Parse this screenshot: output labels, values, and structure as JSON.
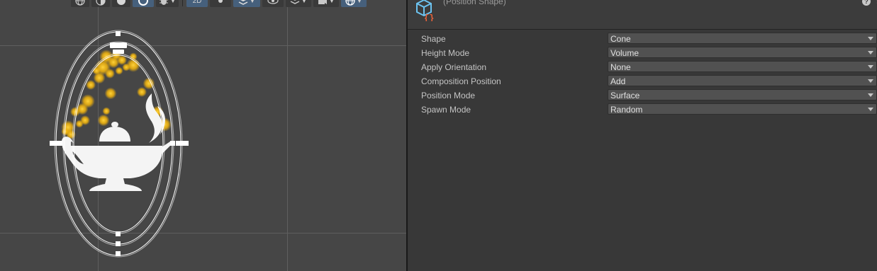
{
  "scene": {
    "toolbar": {
      "mode_2d_label": "2D"
    }
  },
  "inspector": {
    "block_title": "(Position Shape)",
    "help_glyph": "?",
    "menu_glyph": "⋮",
    "properties": [
      {
        "label": "Shape",
        "value": "Cone"
      },
      {
        "label": "Height Mode",
        "value": "Volume"
      },
      {
        "label": "Apply Orientation",
        "value": "None"
      },
      {
        "label": "Composition Position",
        "value": "Add"
      },
      {
        "label": "Position Mode",
        "value": "Surface"
      },
      {
        "label": "Spawn Mode",
        "value": "Random"
      }
    ]
  },
  "colors": {
    "scene_background": "#464646",
    "inspector_background": "#383838",
    "particle": "#f2b40c",
    "gizmo": "#ffffff",
    "block_icon_cube": "#6cc3f0",
    "block_icon_brackets": "#e8623a",
    "active_toolbar_button": "#46607c"
  }
}
